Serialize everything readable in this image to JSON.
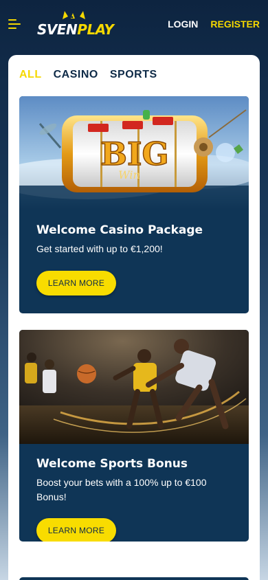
{
  "header": {
    "logo_part1": "SVEN",
    "logo_part2": "PLAY",
    "login": "LOGIN",
    "register": "REGISTER"
  },
  "tabs": [
    {
      "label": "ALL",
      "active": true
    },
    {
      "label": "CASINO",
      "active": false
    },
    {
      "label": "SPORTS",
      "active": false
    }
  ],
  "promos": [
    {
      "title": "Welcome Casino Package",
      "text": "Get started with up to €1,200!",
      "button": "LEARN MORE",
      "image": "slot-machine-big-win-image",
      "image_text": "BIG"
    },
    {
      "title": "Welcome Sports Bonus",
      "text": "Boost your bets with a 100% up to €100 Bonus!",
      "button": "LEARN MORE",
      "image": "basketball-players-image"
    }
  ],
  "colors": {
    "accent": "#f5d800",
    "navy": "#0f3556",
    "text_dark": "#0e2a47"
  }
}
